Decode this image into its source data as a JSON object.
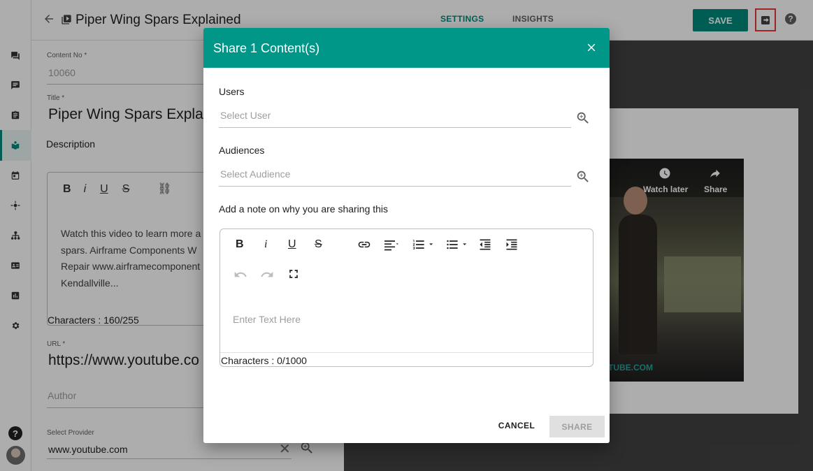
{
  "header": {
    "title": "Piper Wing Spars Explained",
    "tabs": [
      {
        "label": "SETTINGS"
      },
      {
        "label": "INSIGHTS"
      }
    ],
    "save_label": "SAVE",
    "help_label": "?"
  },
  "sidebar": {
    "items": [
      "chat-icon",
      "message-icon",
      "clipboard-icon",
      "book-icon",
      "calendar-icon",
      "settings-nodes-icon",
      "hierarchy-icon",
      "id-card-icon",
      "chart-icon",
      "gear-icon"
    ],
    "help_label": "?"
  },
  "form": {
    "content_no_label": "Content No *",
    "content_no_value": "10060",
    "title_label": "Title *",
    "title_value": "Piper Wing Spars Explai",
    "description_label": "Description",
    "description_text": "Watch this video to learn more a spars. Airframe Components W Repair www.airframecomponent Kendallville...",
    "description_chars": "Characters : 160/255",
    "url_label": "URL *",
    "url_value": "https://www.youtube.co",
    "author_placeholder": "Author",
    "provider_label": "Select Provider",
    "provider_value": "www.youtube.com"
  },
  "preview": {
    "watch_later": "Watch later",
    "share": "Share",
    "url_fragment": "TUBE.COM"
  },
  "modal": {
    "title": "Share 1 Content(s)",
    "users_label": "Users",
    "users_placeholder": "Select User",
    "audiences_label": "Audiences",
    "audiences_placeholder": "Select Audience",
    "note_label": "Add a note on why you are sharing this",
    "editor_placeholder": "Enter Text Here",
    "editor_chars": "Characters : 0/1000",
    "cancel_label": "CANCEL",
    "share_label": "SHARE"
  }
}
